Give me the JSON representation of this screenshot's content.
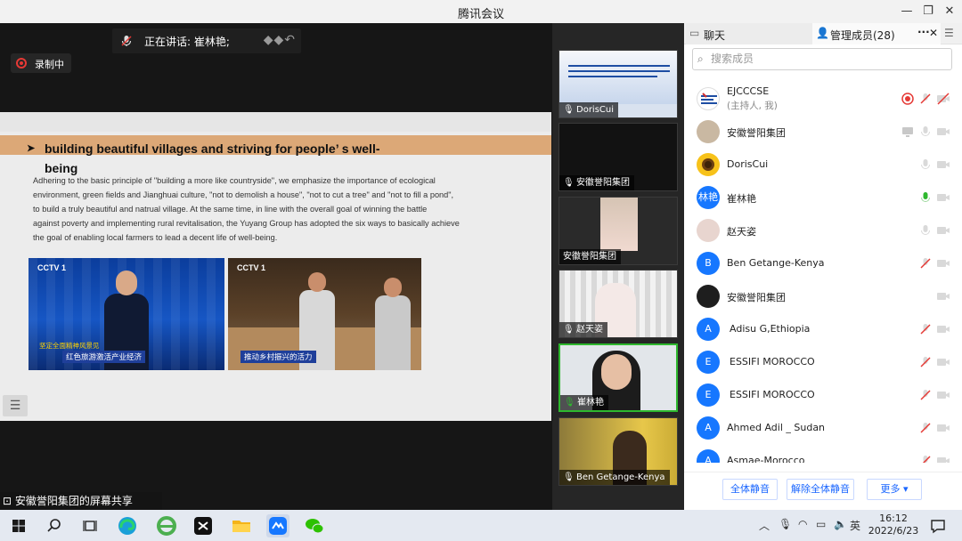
{
  "app": {
    "title": "腾讯会议",
    "colors": {
      "accent": "#1677ff",
      "recording": "#e53935",
      "speaking": "#2eb82e"
    }
  },
  "stage": {
    "speaking_label": "正在讲话: 崔林艳;",
    "recording_label": "录制中",
    "share_label": "安徽誉阳集团的屏幕共享"
  },
  "slide": {
    "heading_line1": "building  beautiful  villages  and  striving  for  people’ s  well-",
    "heading_line2": "being",
    "paragraph": [
      "Adhering to the basic principle of \"building a more like countryside\", we emphasize the importance of ecological",
      "environment, green fields and Jianghuai culture, \"not to demolish a house\", \"not to cut a tree\" and \"not to fill a pond\",",
      "to build a truly beautiful and natrual village. At the same time, in line with the overall goal of winning the battle",
      "against poverty and implementing rural revitalisation, the Yuyang Group has adopted the six ways to basically achieve",
      "the goal of enabling local farmers to lead a decent life of well-being."
    ],
    "image1": {
      "logo": "CCTV 1",
      "caption": "红色旅游激活产业经济",
      "ticker": "坚定全面精神风景见"
    },
    "image2": {
      "logo": "CCTV 1",
      "caption": "推动乡村振兴的活力"
    }
  },
  "tiles": [
    {
      "name": "DorisCui",
      "mic": "on"
    },
    {
      "name": "安徽誉阳集团",
      "mic": "on"
    },
    {
      "name": "安徽誉阳集团",
      "mic": "none"
    },
    {
      "name": "赵天姿",
      "mic": "on"
    },
    {
      "name": "崔林艳",
      "mic": "speaking"
    },
    {
      "name": "Ben Getange-Kenya",
      "mic": "muted"
    }
  ],
  "panel": {
    "tab_chat": "聊天",
    "tab_members": "管理成员(28)",
    "more_glyph": "···",
    "search_placeholder": "搜索成员",
    "members": [
      {
        "name": "EJCCCSE",
        "sub": "(主持人, 我)",
        "avatar": "",
        "avatar_type": "logo"
      },
      {
        "name": "安徽誉阳集团",
        "sub": "",
        "avatar": "",
        "avatar_type": "photo"
      },
      {
        "name": "DorisCui",
        "sub": "",
        "avatar": "",
        "avatar_type": "flower"
      },
      {
        "name": "崔林艳",
        "sub": "",
        "avatar": "林艳",
        "avatar_type": "text"
      },
      {
        "name": "赵天姿",
        "sub": "",
        "avatar": "",
        "avatar_type": "photo2"
      },
      {
        "name": "Ben Getange-Kenya",
        "sub": "",
        "avatar": "B",
        "avatar_type": "text"
      },
      {
        "name": "安徽誉阳集团",
        "sub": "",
        "avatar": "",
        "avatar_type": "dark"
      },
      {
        "name": "Adisu G,Ethiopia",
        "sub": "",
        "avatar": "A",
        "avatar_type": "text"
      },
      {
        "name": "ESSIFI MOROCCO",
        "sub": "",
        "avatar": "E",
        "avatar_type": "text"
      },
      {
        "name": "ESSIFI MOROCCO",
        "sub": "",
        "avatar": "E",
        "avatar_type": "text"
      },
      {
        "name": "Ahmed Adil _ Sudan",
        "sub": "",
        "avatar": "A",
        "avatar_type": "text"
      },
      {
        "name": "Asmae-Morocco",
        "sub": "",
        "avatar": "A",
        "avatar_type": "text"
      }
    ],
    "mute_all": "全体静音",
    "unmute_all": "解除全体静音",
    "more": "更多 ▾"
  },
  "taskbar": {
    "ime": "英",
    "time": "16:12",
    "date": "2022/6/23"
  }
}
